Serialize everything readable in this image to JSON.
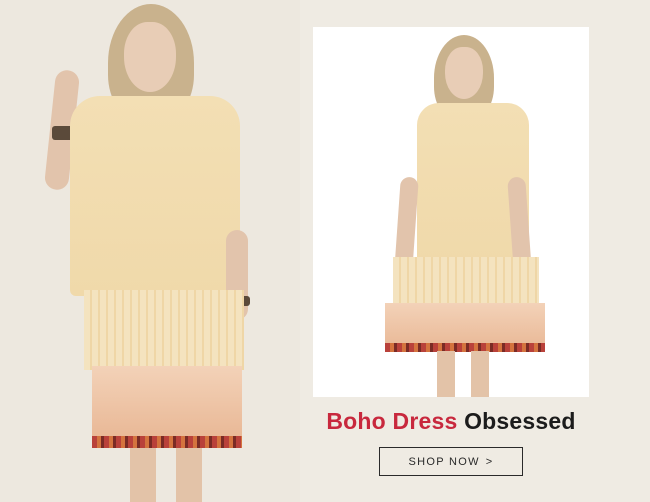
{
  "headline": {
    "accent_text": "Boho Dress",
    "rest_text": "Obsessed",
    "accent_color": "#c8283d"
  },
  "cta": {
    "label": "SHOP NOW",
    "icon": "chevron-right-icon"
  },
  "images": {
    "left_photo": "model-in-boho-dress-photo",
    "card_photo": "model-in-boho-dress-photo"
  }
}
